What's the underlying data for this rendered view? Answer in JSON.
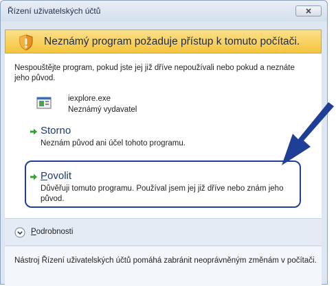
{
  "window": {
    "title": "Řízení uživatelských účtů"
  },
  "banner": {
    "text": "Neznámý program požaduje přístup k tomuto počítači."
  },
  "intro": "Nespouštějte program, pokud jste jej již dříve nepoužívali nebo pokud a neznáte jeho původ.",
  "program": {
    "name": "iexplore.exe",
    "publisher": "Neznámý vydavatel"
  },
  "options": {
    "cancel": {
      "title": "Storno",
      "description": "Neznám původ ani účel tohoto programu."
    },
    "allow": {
      "title_first": "P",
      "title_rest": "ovolit",
      "description": "Důvěřuji tomuto programu. Používal jsem jej již dříve nebo znám jeho původ."
    }
  },
  "details": {
    "label_first": "P",
    "label_rest": "odrobnosti"
  },
  "footer": {
    "text": "Nástroj Řízení uživatelských účtů pomáhá zabránit neoprávněným změnám v počítači."
  },
  "colors": {
    "banner": "#f4c43c",
    "option_arrow": "#2ba52b",
    "highlight": "#1e3f95"
  }
}
